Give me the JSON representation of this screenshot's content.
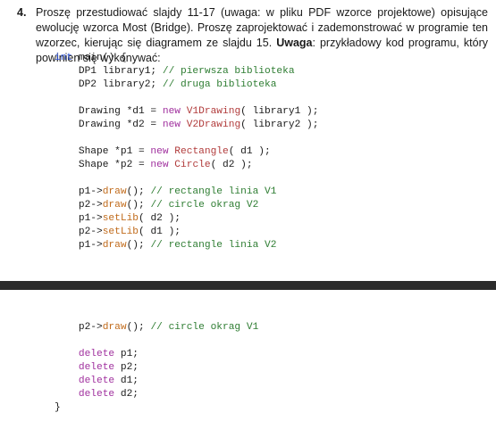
{
  "task": {
    "number": "4.",
    "text_1": "Proszę przestudiować slajdy 11-17 (uwaga: w pliku PDF wzorce projektowe) opisujące ewolucję wzorca Most (Bridge). Proszę zaprojektować i zademonstrować w programie ten wzorzec, kierując się diagramem ze slajdu 15. ",
    "bold_label": "Uwaga",
    "text_2": ": przykładowy kod programu, który powinien się wykonywać:"
  },
  "code": {
    "main_kw": "int",
    "main_sig": " main() {",
    "lines": {
      "l1_pre": "    DP1 library1; ",
      "l1_cmt": "// pierwsza biblioteka",
      "l2_pre": "    DP2 library2; ",
      "l2_cmt": "// druga biblioteka",
      "l3_pre": "    Drawing *d1 = ",
      "l3_new": "new",
      "l3_sp": " ",
      "l3_cls": "V1Drawing",
      "l3_post": "( library1 );",
      "l4_pre": "    Drawing *d2 = ",
      "l4_new": "new",
      "l4_sp": " ",
      "l4_cls": "V2Drawing",
      "l4_post": "( library2 );",
      "l5_pre": "    Shape *p1 = ",
      "l5_new": "new",
      "l5_sp": " ",
      "l5_cls": "Rectangle",
      "l5_post": "( d1 );",
      "l6_pre": "    Shape *p2 = ",
      "l6_new": "new",
      "l6_sp": " ",
      "l6_cls": "Circle",
      "l6_post": "( d2 );",
      "l7_pre": "    p1->",
      "l7_m": "draw",
      "l7_post": "(); ",
      "l7_cmt": "// rectangle linia V1",
      "l8_pre": "    p2->",
      "l8_m": "draw",
      "l8_post": "(); ",
      "l8_cmt": "// circle okrag V2",
      "l9_pre": "    p1->",
      "l9_m": "setLib",
      "l9_post": "( d2 );",
      "l10_pre": "    p2->",
      "l10_m": "setLib",
      "l10_post": "( d1 );",
      "l11_pre": "    p1->",
      "l11_m": "draw",
      "l11_post": "(); ",
      "l11_cmt": "// rectangle linia V2",
      "l12_pre": "    p2->",
      "l12_m": "draw",
      "l12_post": "(); ",
      "l12_cmt": "// circle okrag V1",
      "l13_kw": "    delete",
      "l13_post": " p1;",
      "l14_kw": "    delete",
      "l14_post": " p2;",
      "l15_kw": "    delete",
      "l15_post": " d1;",
      "l16_kw": "    delete",
      "l16_post": " d2;",
      "close": "}"
    }
  }
}
